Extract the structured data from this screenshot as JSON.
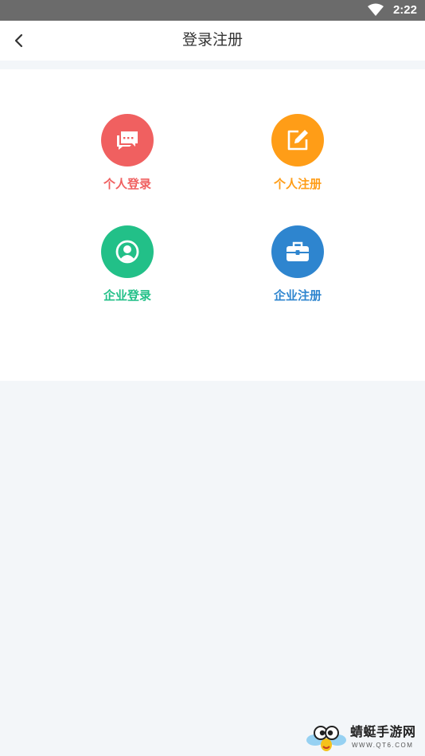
{
  "status_bar": {
    "time": "2:22"
  },
  "header": {
    "title": "登录注册"
  },
  "options": [
    {
      "label": "个人登录",
      "color": "#f06060"
    },
    {
      "label": "个人注册",
      "color": "#ff9d17"
    },
    {
      "label": "企业登录",
      "color": "#22c088"
    },
    {
      "label": "企业注册",
      "color": "#2e85cf"
    }
  ],
  "watermark": {
    "title": "蜻蜓手游网",
    "url": "WWW.QT6.COM"
  }
}
